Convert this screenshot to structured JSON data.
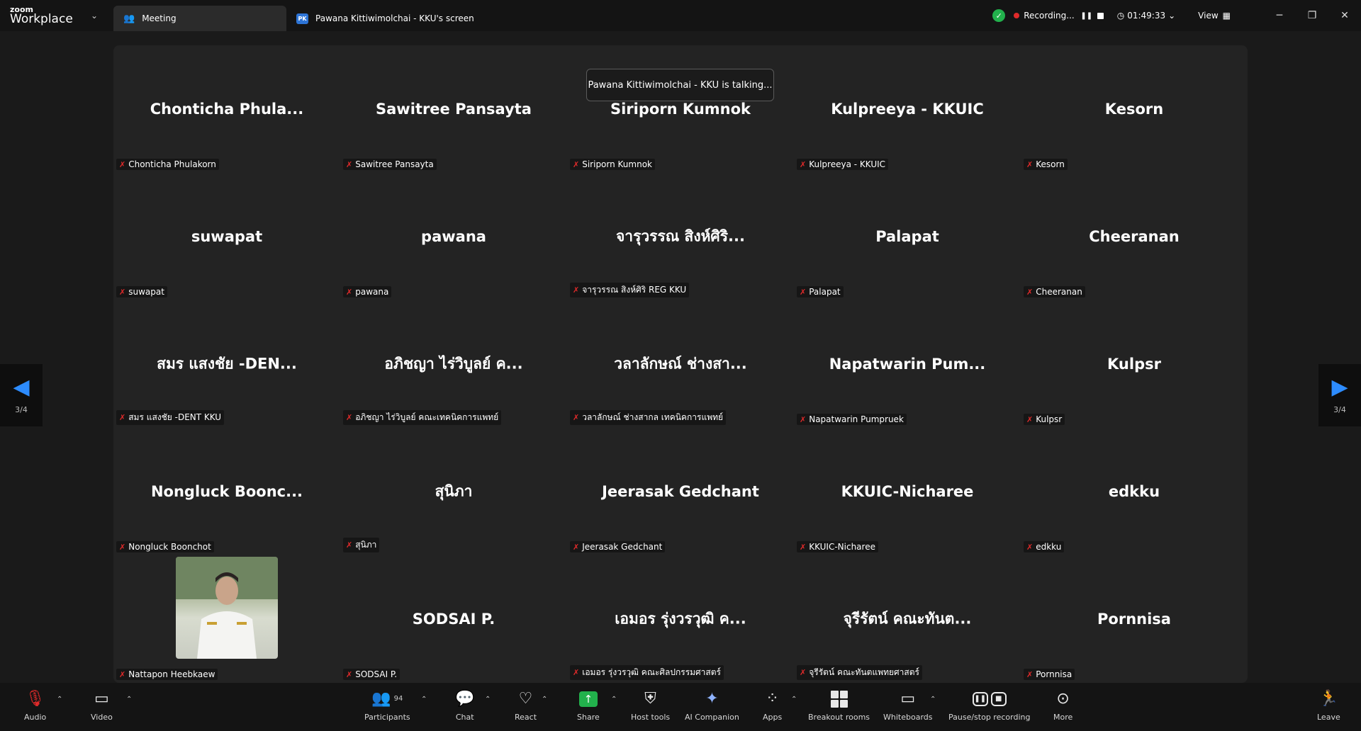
{
  "titlebar": {
    "brand_top": "zoom",
    "brand_bottom": "Workplace",
    "tabs": [
      {
        "label": "Meeting"
      },
      {
        "label": "Pawana Kittiwimolchai - KKU's screen",
        "badge": "PK"
      }
    ],
    "recording_label": "Recording...",
    "timer": "01:49:33",
    "view_label": "View"
  },
  "toast": "Pawana Kittiwimolchai - KKU is talking...",
  "pager": {
    "left_count": "3/4",
    "right_count": "3/4"
  },
  "tiles": [
    {
      "name": "Chonticha  Phula...",
      "label": "Chonticha Phulakorn"
    },
    {
      "name": "Sawitree Pansayta",
      "label": "Sawitree Pansayta"
    },
    {
      "name": "Siriporn Kumnok",
      "label": "Siriporn Kumnok"
    },
    {
      "name": "Kulpreeya - KKUIC",
      "label": "Kulpreeya - KKUIC"
    },
    {
      "name": "Kesorn",
      "label": "Kesorn"
    },
    {
      "name": "suwapat",
      "label": "suwapat"
    },
    {
      "name": "pawana",
      "label": "pawana"
    },
    {
      "name": "จารุวรรณ สิงห์ศิริ...",
      "label": "จารุวรรณ สิงห์ศิริ REG KKU"
    },
    {
      "name": "Palapat",
      "label": "Palapat"
    },
    {
      "name": "Cheeranan",
      "label": "Cheeranan"
    },
    {
      "name": "สมร แสงชัย -DEN...",
      "label": "สมร แสงชัย -DENT KKU"
    },
    {
      "name": "อภิชญา ไร่วิบูลย์ ค...",
      "label": "อภิชญา ไร่วิบูลย์ คณะเทคนิคการแพทย์"
    },
    {
      "name": "วลาลักษณ์ ช่างสา...",
      "label": "วลาลักษณ์ ช่างสากล เทคนิคการแพทย์"
    },
    {
      "name": "Napatwarin  Pum...",
      "label": "Napatwarin Pumpruek"
    },
    {
      "name": "Kulpsr",
      "label": "Kulpsr"
    },
    {
      "name": "Nongluck  Boonc...",
      "label": "Nongluck Boonchot"
    },
    {
      "name": "สุนิภา",
      "label": "สุนิภา"
    },
    {
      "name": "Jeerasak Gedchant",
      "label": "Jeerasak Gedchant"
    },
    {
      "name": "KKUIC-Nicharee",
      "label": "KKUIC-Nicharee"
    },
    {
      "name": "edkku",
      "label": "edkku"
    },
    {
      "name": "",
      "label": "Nattapon Heebkaew",
      "has_photo": true
    },
    {
      "name": "SODSAI P.",
      "label": "SODSAI P."
    },
    {
      "name": "เอมอร รุ่งวรวุฒิ ค...",
      "label": "เอมอร รุ่งวรวุฒิ คณะศิลปกรรมศาสตร์"
    },
    {
      "name": "จุรีรัตน์ คณะทันต...",
      "label": "จุรีรัตน์ คณะทันตแพทยศาสตร์"
    },
    {
      "name": "Pornnisa",
      "label": "Pornnisa"
    }
  ],
  "toolbar": {
    "audio": "Audio",
    "video": "Video",
    "participants": "Participants",
    "participants_count": "94",
    "chat": "Chat",
    "react": "React",
    "share": "Share",
    "host_tools": "Host tools",
    "ai_companion": "AI Companion",
    "apps": "Apps",
    "breakout_rooms": "Breakout rooms",
    "whiteboards": "Whiteboards",
    "pause_recording": "Pause/stop recording",
    "more": "More",
    "leave": "Leave"
  },
  "colors": {
    "accent": "#2d8cff",
    "share_green": "#22b14c",
    "muted_red": "#e02a2a",
    "background": "#1a1a1a",
    "tile_background": "#232323"
  }
}
